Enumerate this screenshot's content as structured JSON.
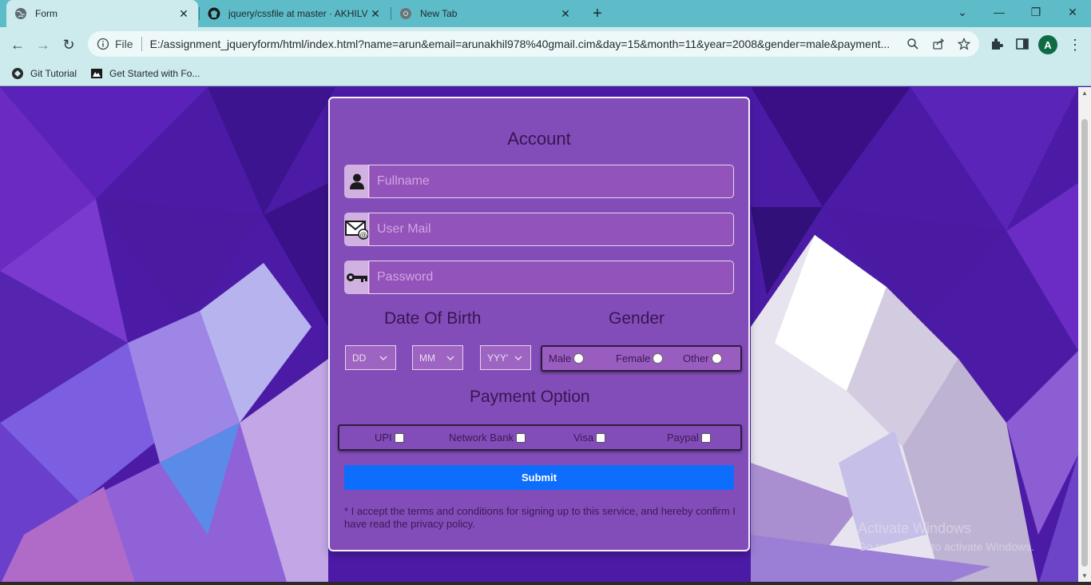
{
  "tabs": [
    {
      "title": "Form",
      "icon": "globe-icon",
      "active": true
    },
    {
      "title": "jquery/cssfile at master · AKHILV",
      "icon": "github-icon",
      "active": false
    },
    {
      "title": "New Tab",
      "icon": "chrome-icon",
      "active": false
    }
  ],
  "toolbar": {
    "file_label": "File",
    "url": "E:/assignment_jqueryform/html/index.html?name=arun&email=arunakhil978%40gmail.cim&day=15&month=11&year=2008&gender=male&payment...",
    "profile_initial": "A"
  },
  "bookmarks": [
    {
      "label": "Git Tutorial",
      "icon": "github-icon"
    },
    {
      "label": "Get Started with Fo...",
      "icon": "bookmark-icon"
    }
  ],
  "form": {
    "title": "Account",
    "fullname_placeholder": "Fullname",
    "email_placeholder": "User Mail",
    "password_placeholder": "Password",
    "dob_heading": "Date Of Birth",
    "gender_heading": "Gender",
    "day_label": "DD",
    "month_label": "MM",
    "year_label": "YYY'",
    "gender_options": [
      "Male",
      "Female",
      "Other"
    ],
    "payment_heading": "Payment Option",
    "payment_options": [
      "UPI",
      "Network Bank",
      "Visa",
      "Paypal"
    ],
    "submit_label": "Submit",
    "terms_text": "* I accept the terms and conditions for signing up to this service, and hereby confirm I have read the privacy policy."
  },
  "watermark": {
    "line1": "Activate Windows",
    "line2": "Go to Settings to activate Windows."
  },
  "colors": {
    "tab_bar": "#5ebcc9",
    "toolbar": "#cdeaed",
    "submit": "#0d6efd",
    "card": "#b076c8"
  }
}
